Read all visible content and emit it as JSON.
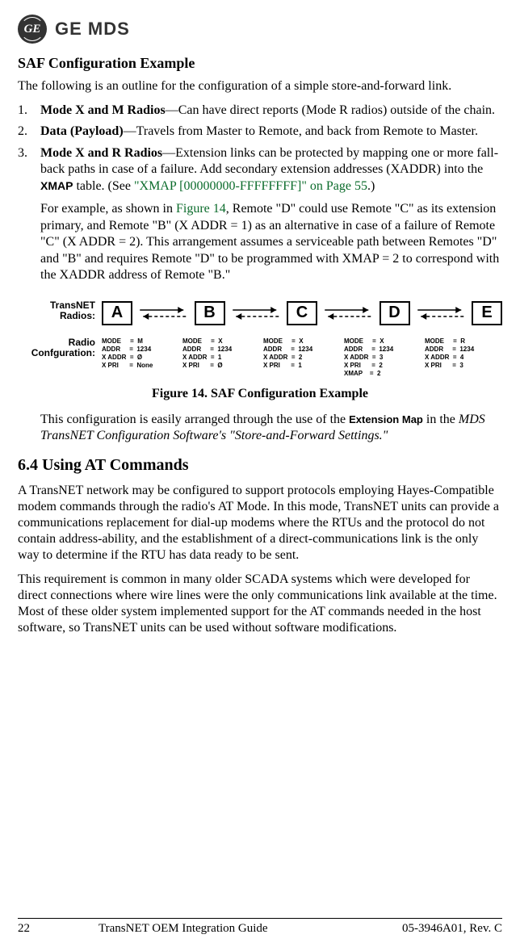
{
  "header": {
    "logo_text": "GE MDS",
    "monogram": "GE"
  },
  "section1_title": "SAF Configuration Example",
  "intro": "The following is an outline for the configuration of a simple store-and-forward link.",
  "list": {
    "item1_num": "1.",
    "item1_bold": "Mode X and M Radios",
    "item1_rest": "—Can have direct reports (Mode R radios) outside of the chain.",
    "item2_num": "2.",
    "item2_bold": "Data (Payload)",
    "item2_rest": "—Travels from Master to Remote, and back from Remote to Master.",
    "item3_num": "3.",
    "item3_bold": "Mode X and R Radios",
    "item3_rest_a": "—Extension links can be protected by mapping one or more fall-back paths in case of a failure. Add secondary extension addresses (XADDR) into the ",
    "item3_xmap": "XMAP",
    "item3_rest_b": " table. (See ",
    "item3_link": "\"XMAP [00000000-FFFFFFFF]\" on Page 55",
    "item3_rest_c": ".)"
  },
  "example_para_a": "For example, as shown in ",
  "example_link": "Figure 14",
  "example_para_b": ", Remote \"D\" could use Remote \"C\" as its extension primary, and Remote \"B\" (X ADDR = 1) as an alternative in case of a failure of Remote \"C\" (X ADDR = 2). This arrangement assumes a serviceable path between Remotes \"D\" and \"B\" and requires Remote \"D\" to be programmed with XMAP = 2 to correspond with the XADDR address of Remote \"B.\"",
  "diagram": {
    "label_radios": "TransNET\nRadios:",
    "label_config": "Radio\nConfguration:",
    "nodes": {
      "a": "A",
      "b": "B",
      "c": "C",
      "d": "D",
      "e": "E"
    },
    "cfg_a": "MODE     =  M\nADDR     =  1234\nX ADDR  =  Ø\nX PRI      =  None",
    "cfg_b": "MODE     =  X\nADDR     =  1234\nX ADDR  =  1\nX PRI      =  Ø",
    "cfg_c": "MODE     =  X\nADDR     =  1234\nX ADDR  =  2\nX PRI      =  1",
    "cfg_d": "MODE     =  X\nADDR     =  1234\nX ADDR  =  3\nX PRI      =  2\nXMAP    =  2",
    "cfg_e": "MODE     =  R\nADDR     =  1234\nX ADDR  =  4\nX PRI      =  3"
  },
  "figure_caption": "Figure 14. SAF Configuration Example",
  "config_para_a": "This configuration is easily arranged through the use of the ",
  "config_extmap": "Extension Map",
  "config_para_b": " in the ",
  "config_italic": "MDS TransNET Configuration Software's \"Store-and-Forward Settings.\"",
  "section2_title": "6.4  Using AT Commands",
  "at_para1": "A TransNET network may be configured to support protocols employing Hayes-Compatible modem commands through the radio's AT Mode. In this mode, TransNET units can provide a communications replacement for dial-up modems where the RTUs and the protocol do not contain address-ability, and the establishment of a direct-communications link is the only way to determine if the RTU has data ready to be sent.",
  "at_para2": "This requirement is common in many older SCADA systems which were developed for direct connections where wire lines were the only communications link available at the time. Most of these older system implemented support for the AT commands needed in the host software, so TransNET units can be used without software modifications.",
  "footer": {
    "page": "22",
    "title": "TransNET OEM Integration Guide",
    "rev": "05-3946A01, Rev. C"
  }
}
